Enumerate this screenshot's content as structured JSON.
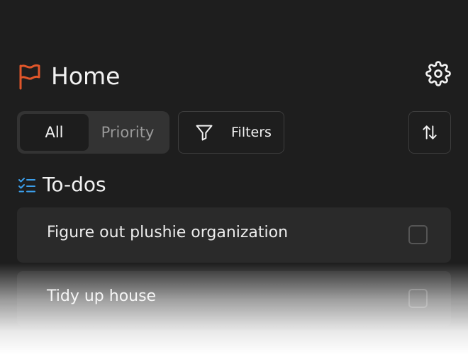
{
  "header": {
    "icon": "flag-icon",
    "icon_color": "#e0562a",
    "title": "Home",
    "settings_icon": "gear-icon"
  },
  "view_toggle": {
    "options": [
      {
        "label": "All",
        "selected": true
      },
      {
        "label": "Priority",
        "selected": false
      }
    ]
  },
  "filters": {
    "icon": "filter-icon",
    "label": "Filters"
  },
  "sort": {
    "icon": "sort-arrows-icon"
  },
  "todos_section": {
    "icon": "checklist-icon",
    "icon_color": "#3b9eea",
    "title": "To-dos"
  },
  "tasks": [
    {
      "title": "Figure out plushie organization",
      "checked": false
    },
    {
      "title": "Tidy up house",
      "checked": false
    }
  ]
}
